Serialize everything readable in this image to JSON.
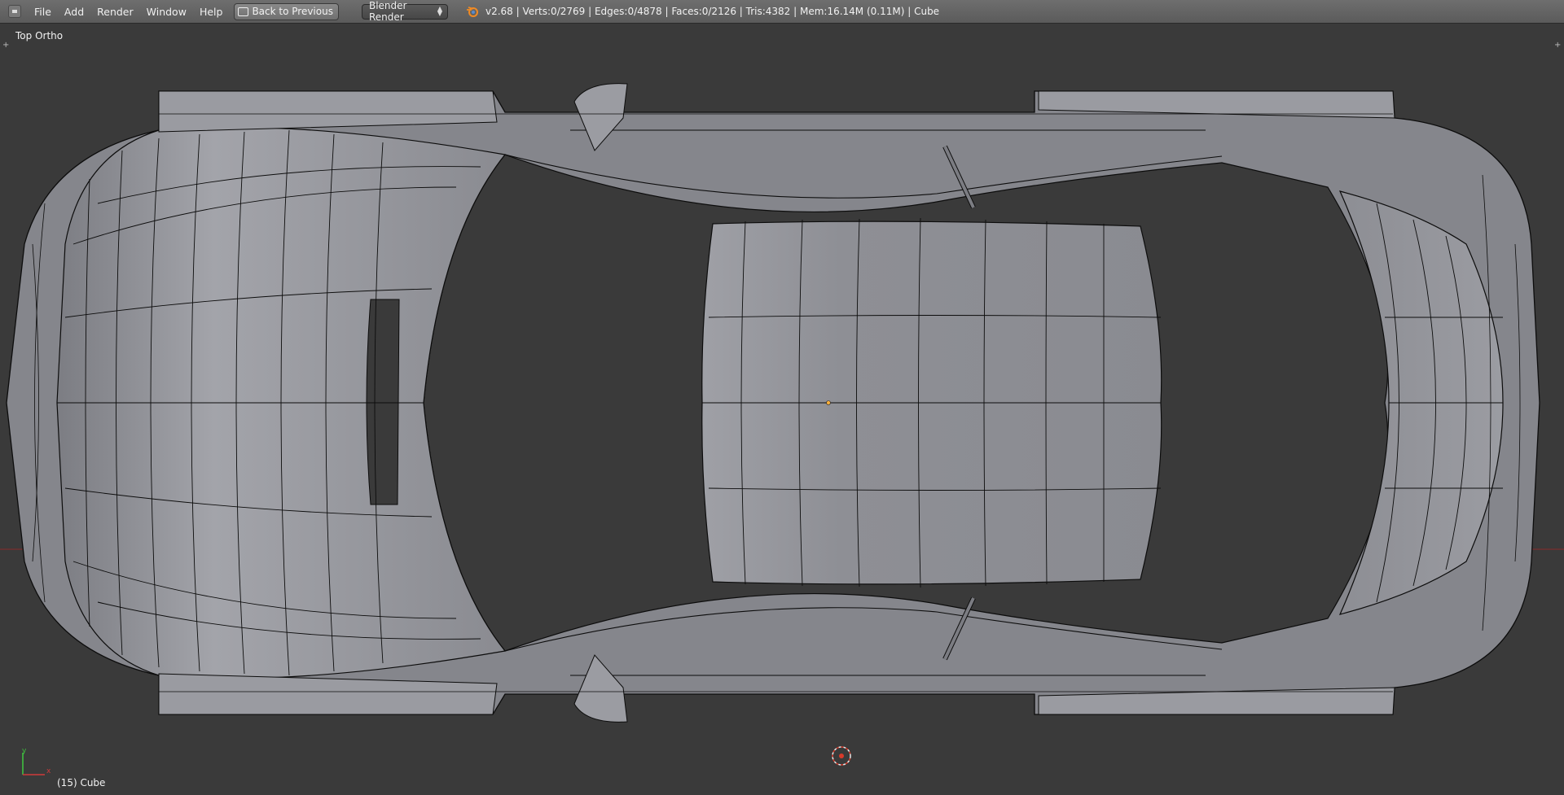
{
  "menubar": {
    "items": [
      "File",
      "Add",
      "Render",
      "Window",
      "Help"
    ],
    "back_button_label": "Back to Previous",
    "render_engine": "Blender Render",
    "stats": "v2.68 | Verts:0/2769 | Edges:0/4878 | Faces:0/2126 | Tris:4382 | Mem:16.14M (0.11M) | Cube"
  },
  "viewport": {
    "view_name": "Top Ortho",
    "object_label": "(15) Cube",
    "axis_x_label": "x",
    "axis_y_label": "y"
  },
  "colors": {
    "header": "#6e6e6e",
    "viewport_bg": "#3a3a3a",
    "mesh_face": "#8e8f95",
    "wire": "#0c0c0c",
    "x_axis": "#8a2a2a",
    "origin": "#ffb03a"
  }
}
